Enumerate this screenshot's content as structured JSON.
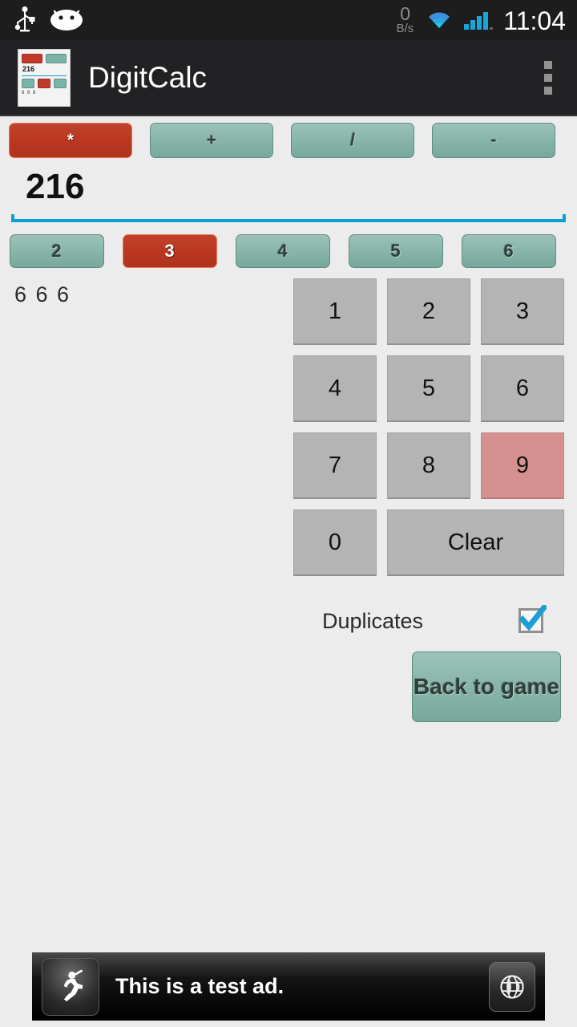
{
  "status_bar": {
    "icons": [
      "usb-icon",
      "android-head-icon",
      "wifi-icon",
      "signal-icon"
    ],
    "net_speed_value": "0",
    "net_speed_unit": "B/s",
    "clock": "11:04"
  },
  "action_bar": {
    "app_title": "DigitCalc",
    "app_icon": {
      "name": "app-launcher-icon",
      "mini_value": "216",
      "mini_footer": "6 6 6"
    },
    "overflow_menu": "overflow-menu-icon"
  },
  "operators": {
    "selected": "*",
    "items": [
      {
        "label": "*",
        "selected": true
      },
      {
        "label": "+",
        "selected": false
      },
      {
        "label": "/",
        "selected": false
      },
      {
        "label": "-",
        "selected": false
      }
    ]
  },
  "display": {
    "value": "216",
    "accent_color": "#0d9fd8"
  },
  "digit_counts": {
    "selected": "3",
    "items": [
      {
        "label": "2",
        "selected": false
      },
      {
        "label": "3",
        "selected": true
      },
      {
        "label": "4",
        "selected": false
      },
      {
        "label": "5",
        "selected": false
      },
      {
        "label": "6",
        "selected": false
      }
    ]
  },
  "preview": {
    "text": "6 6 6"
  },
  "keypad": {
    "rows": [
      [
        {
          "label": "1",
          "highlight": false
        },
        {
          "label": "2",
          "highlight": false
        },
        {
          "label": "3",
          "highlight": false
        }
      ],
      [
        {
          "label": "4",
          "highlight": false
        },
        {
          "label": "5",
          "highlight": false
        },
        {
          "label": "6",
          "highlight": false
        }
      ],
      [
        {
          "label": "7",
          "highlight": false
        },
        {
          "label": "8",
          "highlight": false
        },
        {
          "label": "9",
          "highlight": true
        }
      ]
    ],
    "zero_label": "0",
    "clear_label": "Clear",
    "highlight_color": "#d4918f",
    "key_color": "#b4b4b4"
  },
  "options": {
    "duplicates_label": "Duplicates",
    "duplicates_checked": true,
    "checkbox_color": "#1e9ed4"
  },
  "actions": {
    "back_label": "Back to game"
  },
  "ad": {
    "text": "This is a test ad.",
    "left_icon": "runner-icon",
    "right_icon": "globe-icon"
  },
  "theme": {
    "background": "#ececed",
    "teal": "#8ab6ab",
    "red": "#b9361f",
    "action_bar_bg": "#222224",
    "status_bar_bg": "#1d1d1d"
  }
}
